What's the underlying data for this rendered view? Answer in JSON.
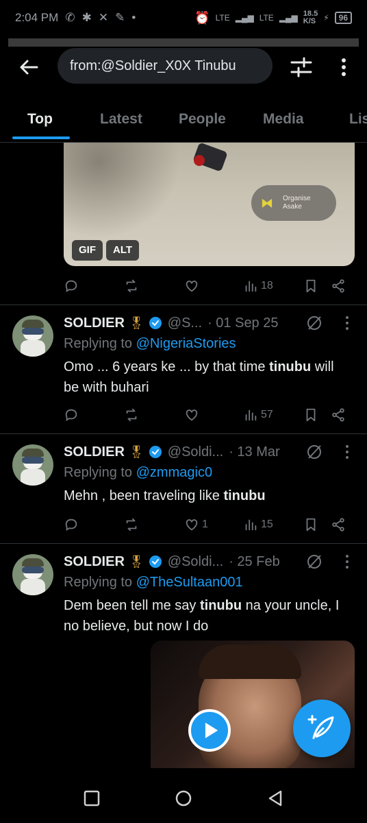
{
  "status_bar": {
    "time": "2:04 PM",
    "network": "LTE",
    "network2": "LTE",
    "speed": "18.5",
    "speed_unit": "K/S",
    "battery": "96"
  },
  "header": {
    "search_query": "from:@Soldier_X0X Tinubu"
  },
  "tabs": [
    {
      "label": "Top",
      "active": true
    },
    {
      "label": "Latest",
      "active": false
    },
    {
      "label": "People",
      "active": false
    },
    {
      "label": "Media",
      "active": false
    },
    {
      "label": "Lis",
      "active": false
    }
  ],
  "first_tweet": {
    "media_overlay_title": "Organise",
    "media_overlay_sub": "Asake",
    "gif_badge": "GIF",
    "alt_badge": "ALT",
    "views": "18"
  },
  "tweets": [
    {
      "name": "SOLDIER",
      "medal": "🎖",
      "handle": "@S...",
      "date": "· 01 Sep 25",
      "replying_prefix": "Replying to ",
      "replying_to": "@NigeriaStories",
      "body_parts": [
        "Omo ... 6 years ke ... by that time ",
        "tinubu",
        " will be with buhari"
      ],
      "likes": "",
      "views": "57"
    },
    {
      "name": "SOLDIER",
      "medal": "🎖",
      "handle": "@Soldi...",
      "date": "· 13 Mar",
      "replying_prefix": "Replying to ",
      "replying_to": "@zmmagic0",
      "body_parts": [
        "Mehn , been traveling like ",
        "tinubu",
        ""
      ],
      "likes": "1",
      "views": "15"
    },
    {
      "name": "SOLDIER",
      "medal": "🎖",
      "handle": "@Soldi...",
      "date": "· 25 Feb",
      "replying_prefix": "Replying to ",
      "replying_to": "@TheSultaan001",
      "body_parts": [
        "Dem been tell me say ",
        "tinubu",
        " na your uncle, I no believe, but now I do"
      ],
      "likes": "",
      "views": ""
    }
  ],
  "colors": {
    "accent": "#1d9bf0",
    "muted": "#71767b",
    "text": "#e7e9ea",
    "background": "#000000"
  }
}
